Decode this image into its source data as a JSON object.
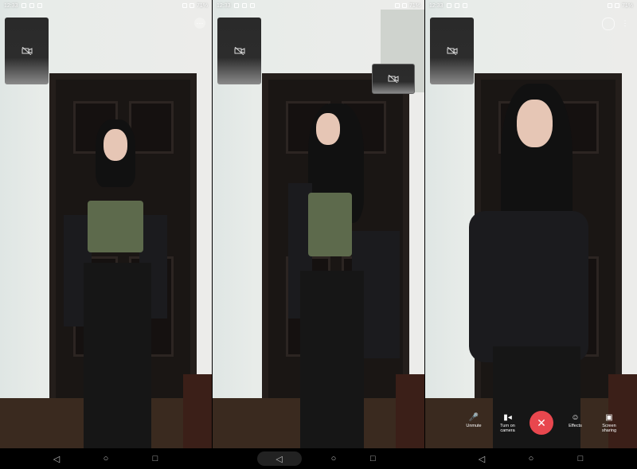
{
  "status_bar": {
    "time": "12:33",
    "battery": "71%"
  },
  "controls": {
    "unmute_label": "Unmute",
    "camera_label": "Turn on camera",
    "effects_label": "Effects",
    "screen_label": "Screen sharing",
    "end_call_symbol": "✕"
  },
  "nav": {
    "back": "◁",
    "home": "○",
    "recents": "□"
  },
  "colors": {
    "end_call": "#e8474e",
    "top_green": "#5d6a4c",
    "door": "#1a1614"
  }
}
